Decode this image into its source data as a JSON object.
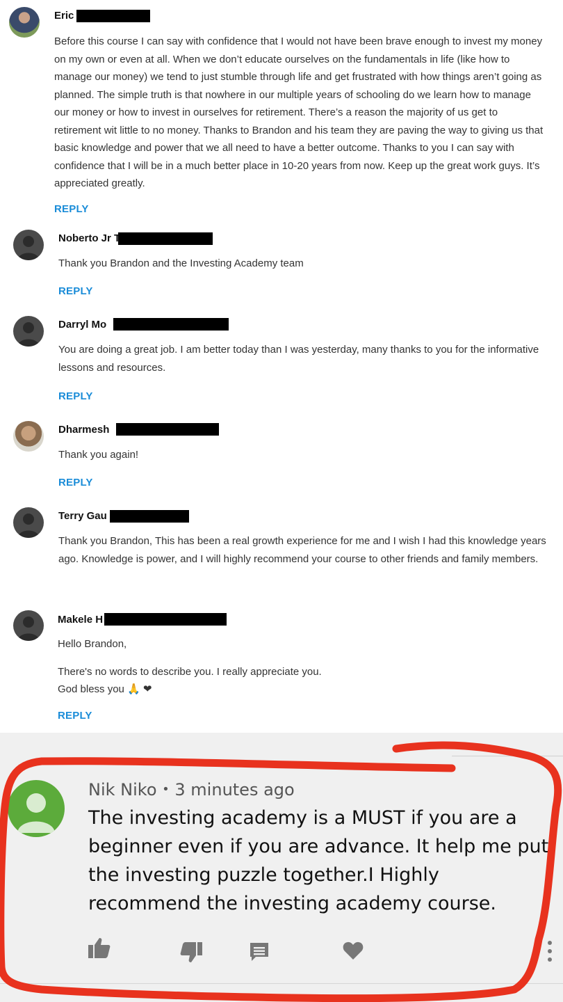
{
  "comments": [
    {
      "name": "Eric",
      "text": "Before this course I can say with confidence that I would not have been brave enough to invest my money on my own or even at all. When we don’t educate ourselves on the fundamentals in life (like how to manage our money) we tend to just stumble through life and get frustrated with how things aren’t going as planned. The simple truth is that nowhere in our multiple years of schooling do we learn how to manage our money or how to invest in ourselves for retirement. There’s a reason the majority of us get to retirement wit little to no money. Thanks to Brandon and his team they are paving the way to giving us that basic knowledge and power that we all need to have a better outcome. Thanks to you I can say with confidence that I will be in a much better place in 10-20 years from now. Keep up the great work guys. It’s appreciated greatly.",
      "reply": "REPLY"
    },
    {
      "name": "Noberto Jr T",
      "text": "Thank you Brandon and the Investing Academy team",
      "reply": "REPLY"
    },
    {
      "name": "Darryl Mo",
      "text": "You are doing a great job. I am better today than I was yesterday, many thanks to you for the informative lessons and resources.",
      "reply": "REPLY"
    },
    {
      "name": "Dharmesh",
      "text": "Thank you again!",
      "reply": "REPLY"
    },
    {
      "name": "Terry Gau",
      "text": "Thank you Brandon, This has been a real growth experience for me and I wish I had this knowledge years ago. Knowledge is power, and I will highly recommend your course to other friends and family members.",
      "reply": "REPLY"
    },
    {
      "name": "Makele H",
      "greeting": "Hello Brandon,",
      "line1": "There's no words to describe you. I really appreciate you.",
      "line2": "God bless you 🙏 ❤",
      "reply": "REPLY"
    }
  ],
  "highlight": {
    "author": "Nik Niko",
    "separator": "•",
    "time": "3 minutes ago",
    "text": "The investing academy is a MUST if you are a beginner even if you are advance. It help me put the investing puzzle together.I Highly recommend the investing academy course."
  },
  "icons": [
    "thumbs-up-icon",
    "thumbs-down-icon",
    "reply-comment-icon",
    "heart-icon",
    "more-options-icon"
  ],
  "colors": {
    "reply": "#1a8cd8",
    "highlight_circle": "#e8321e",
    "avatar_green": "#5cab3b",
    "bottom_bg": "#f0f0f0"
  }
}
